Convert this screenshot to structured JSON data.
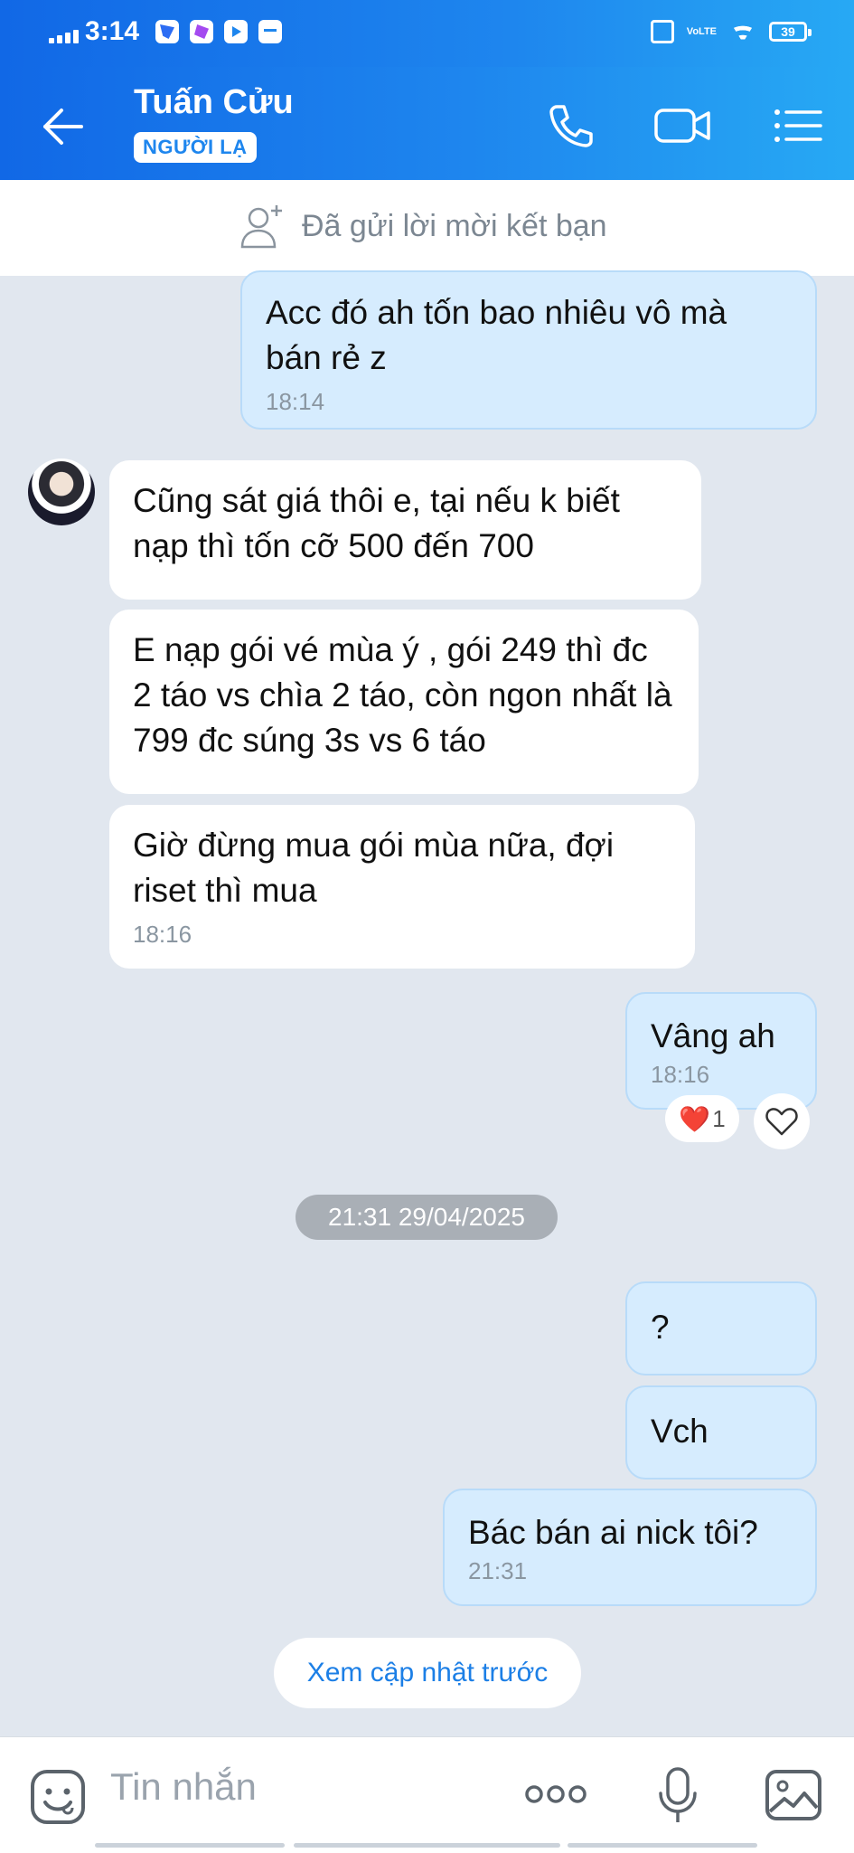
{
  "status_bar": {
    "time": "3:14",
    "battery": "39",
    "network": "VoLTE"
  },
  "header": {
    "contact_name": "Tuấn Cửu",
    "badge": "NGƯỜI LẠ",
    "icons": [
      "back-arrow-icon",
      "phone-icon",
      "video-camera-icon",
      "menu-list-icon"
    ]
  },
  "friend_request": {
    "text": "Đã gửi lời mời kết bạn",
    "icon": "add-person-icon"
  },
  "messages": [
    {
      "direction": "out",
      "text": "Acc đó ah tốn bao nhiêu vô mà bán rẻ z",
      "time": "18:14"
    },
    {
      "direction": "in",
      "text": "Cũng sát giá thôi e, tại nếu k biết nạp thì tốn cỡ 500 đến 700"
    },
    {
      "direction": "in",
      "text": "E nạp gói vé mùa ý , gói 249 thì đc 2 táo vs chìa 2 táo, còn ngon nhất là 799 đc súng 3s vs 6 táo"
    },
    {
      "direction": "in",
      "text": "Giờ đừng mua gói mùa nữa, đợi riset thì mua",
      "time": "18:16"
    },
    {
      "direction": "out",
      "text": "Vâng ah",
      "time": "18:16",
      "reaction": {
        "emoji": "❤️",
        "count": "1"
      }
    },
    {
      "direction": "out",
      "text": "?"
    },
    {
      "direction": "out",
      "text": "Vch"
    },
    {
      "direction": "out",
      "text": "Bác bán ai nick tôi?",
      "time": "21:31"
    }
  ],
  "date_separator": "21:31 29/04/2025",
  "load_previous": "Xem cập nhật trước",
  "composer": {
    "placeholder": "Tin nhắn",
    "icons": [
      "sticker-icon",
      "more-icon",
      "microphone-icon",
      "image-icon"
    ]
  },
  "colors": {
    "header": "#1e86ee",
    "outgoing_bubble": "#d6ecfe",
    "incoming_bubble": "#ffffff",
    "chat_bg": "#e1e7ef",
    "accent": "#1c7fe6"
  }
}
